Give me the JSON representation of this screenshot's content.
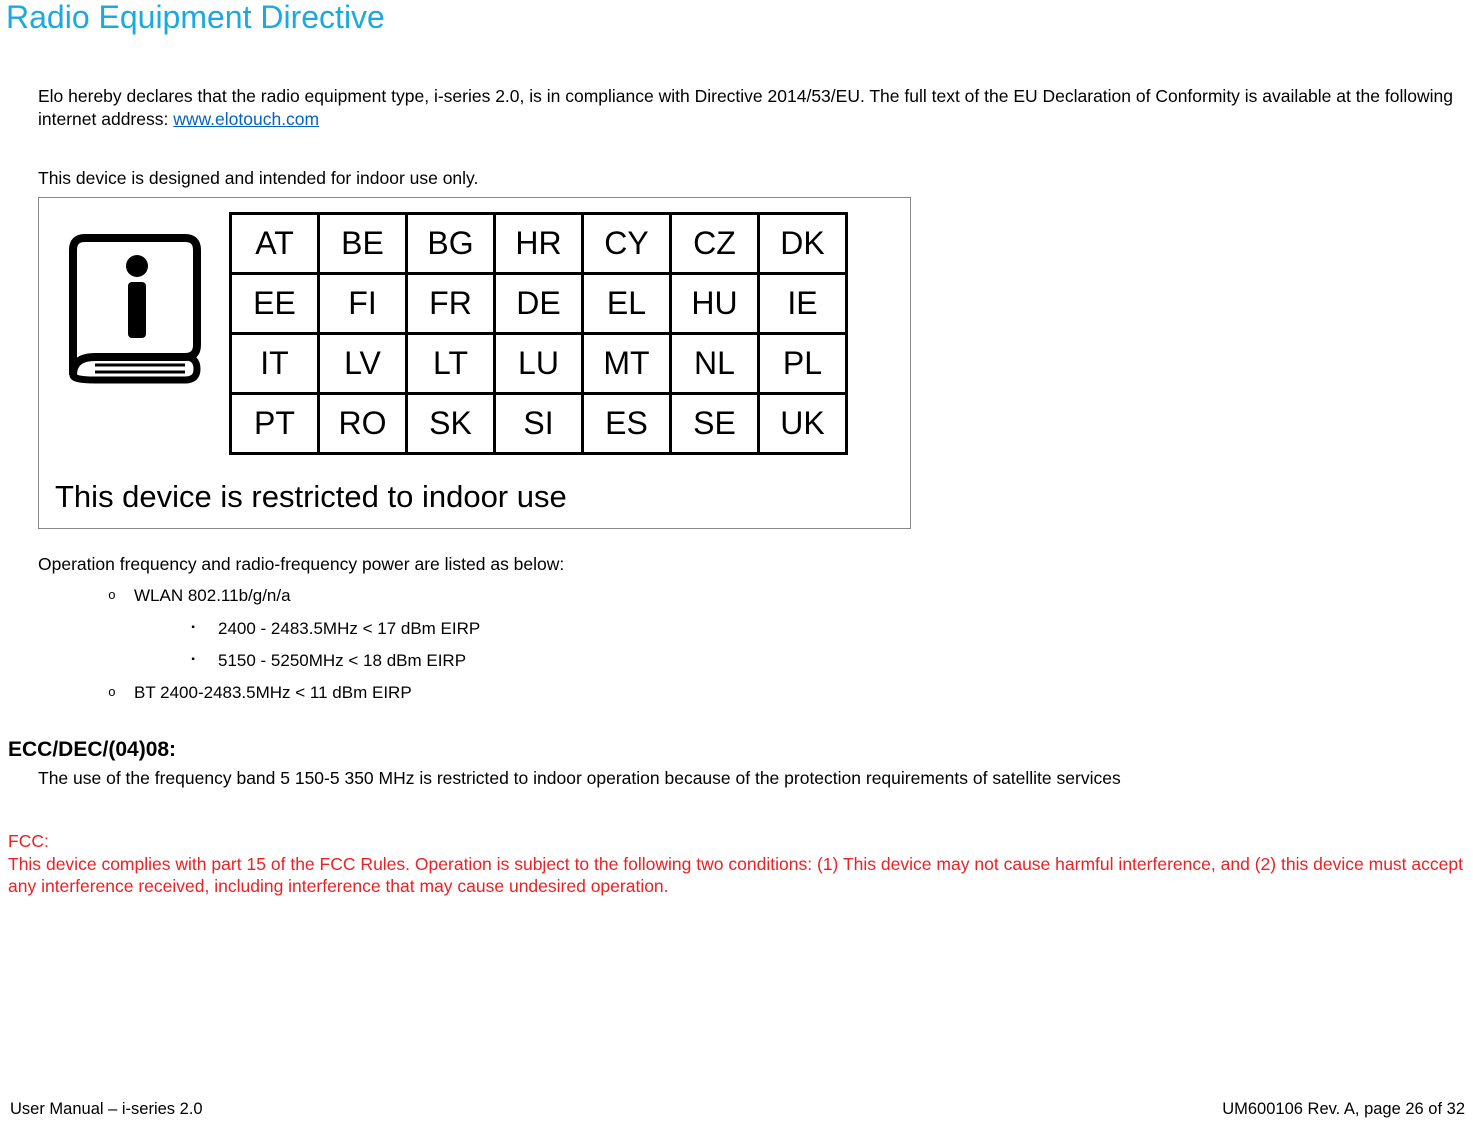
{
  "title": "Radio Equipment Directive",
  "declaration_line1": "Elo hereby declares that the radio equipment type, i-series 2.0, is in compliance with Directive 2014/53/EU. The full text of the EU Declaration of Conformity is available at the following internet address: ",
  "declaration_link": "www.elotouch.com",
  "indoor_intent": "This device is designed and intended for indoor use only.",
  "countries": {
    "row1": [
      "AT",
      "BE",
      "BG",
      "HR",
      "CY",
      "CZ",
      "DK"
    ],
    "row2": [
      "EE",
      "FI",
      "FR",
      "DE",
      "EL",
      "HU",
      "IE"
    ],
    "row3": [
      "IT",
      "LV",
      "LT",
      "LU",
      "MT",
      "NL",
      "PL"
    ],
    "row4": [
      "PT",
      "RO",
      "SK",
      "SI",
      "ES",
      "SE",
      "UK"
    ]
  },
  "restriction_text": "This device is restricted to indoor use",
  "freq_intro": "Operation frequency and radio-frequency power are listed as below:",
  "item_wlan": "WLAN  802.11b/g/n/a",
  "item_wlan_sub1": "2400 - 2483.5MHz  <  17 dBm EIRP",
  "item_wlan_sub2": "5150 - 5250MHz  <  18 dBm EIRP",
  "item_bt": "BT 2400-2483.5MHz  <  11 dBm EIRP",
  "ecc_heading": "ECC/DEC/(04)08:",
  "ecc_text": "The use of the frequency band 5 150-5 350 MHz is restricted to indoor operation because of the protection requirements of satellite services",
  "fcc_label": "FCC:",
  "fcc_text": "This device complies with part 15 of the FCC Rules. Operation is subject to the following two conditions: (1) This device may not cause harmful interference, and (2) this device must accept any interference received, including interference that may cause undesired operation.",
  "footer_left": "User Manual – i-series 2.0",
  "footer_right": "UM600106 Rev. A, page 26 of 32"
}
